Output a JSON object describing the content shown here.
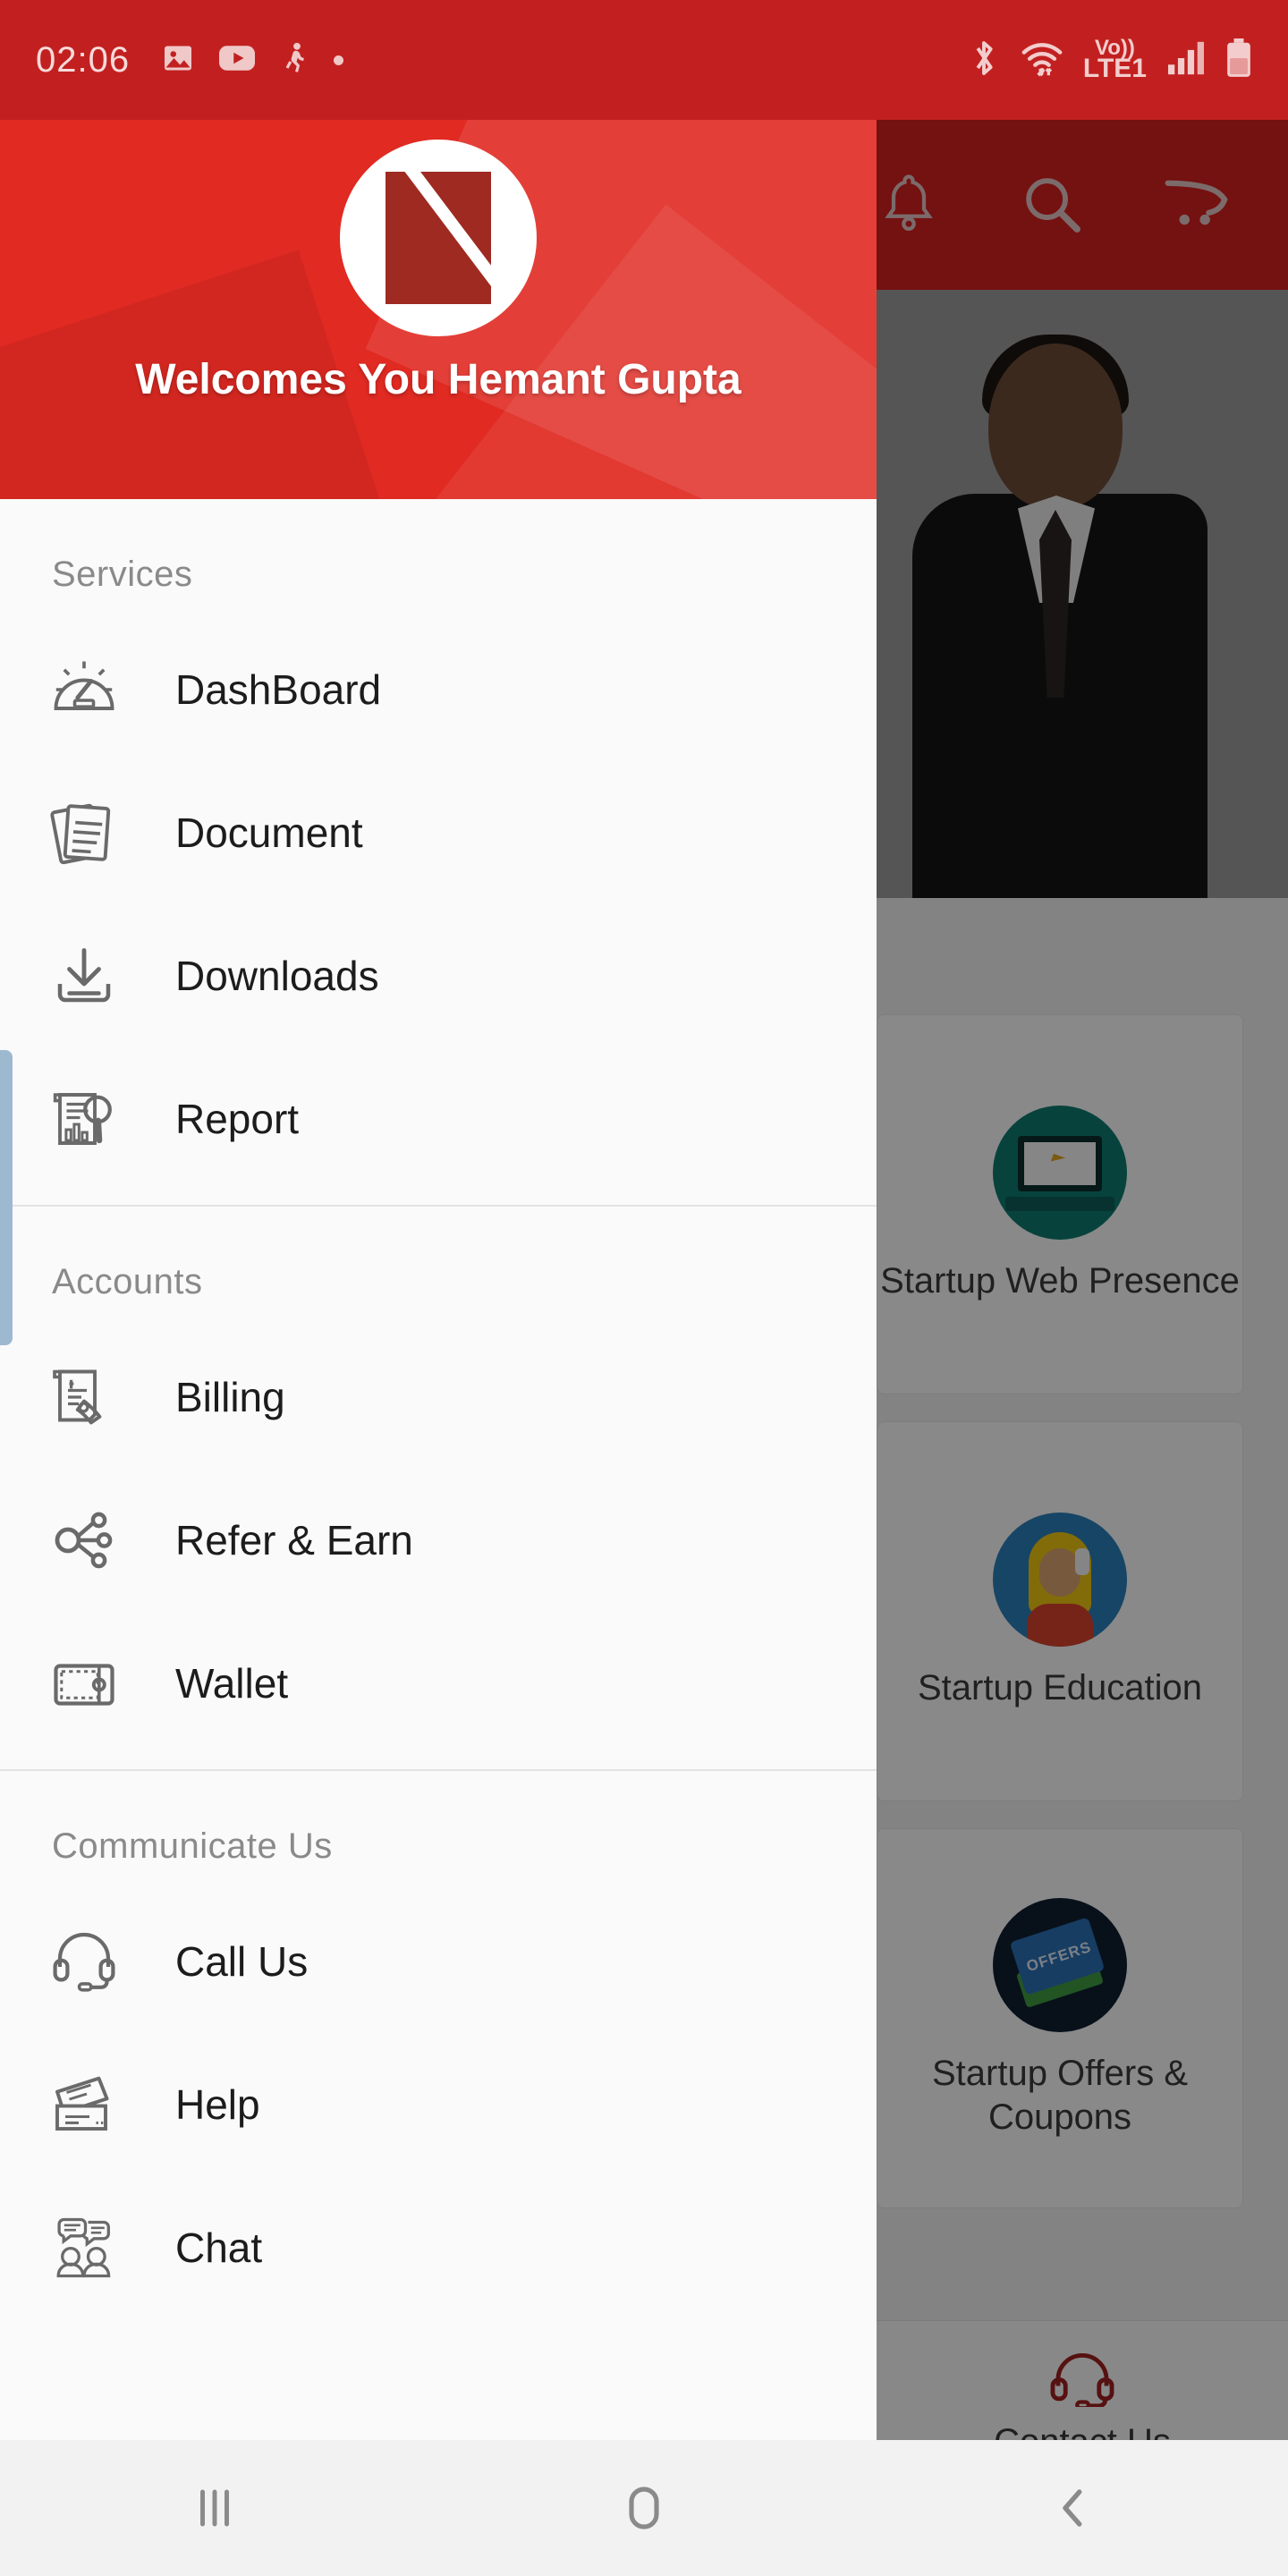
{
  "status_bar": {
    "clock": "02:06",
    "left_icons": [
      "gallery-icon",
      "youtube-icon",
      "fitness-icon",
      "dot-indicator"
    ],
    "right_icons": [
      "bluetooth-icon",
      "wifi-icon",
      "signal-icon",
      "battery-icon"
    ],
    "network_label_top": "Vo))",
    "network_label_bottom": "LTE1",
    "background_color": "#c22020"
  },
  "toolbar": {
    "background_color": "#d32020",
    "actions": [
      {
        "name": "notifications-icon",
        "label": "Notifications"
      },
      {
        "name": "search-icon",
        "label": "Search"
      },
      {
        "name": "cart-icon",
        "label": "Cart"
      }
    ]
  },
  "drawer": {
    "header": {
      "welcome_text": "Welcomes You  Hemant Gupta",
      "user_name": "Hemant Gupta",
      "logo_name": "app-logo",
      "background_color": "#e02a22"
    },
    "sections": [
      {
        "title": "Services",
        "items": [
          {
            "label": "DashBoard",
            "icon": "speedometer-icon"
          },
          {
            "label": "Document",
            "icon": "documents-icon"
          },
          {
            "label": "Downloads",
            "icon": "download-icon"
          },
          {
            "label": "Report",
            "icon": "report-search-icon"
          }
        ]
      },
      {
        "title": "Accounts",
        "items": [
          {
            "label": "Billing",
            "icon": "invoice-icon"
          },
          {
            "label": "Refer & Earn",
            "icon": "share-network-icon"
          },
          {
            "label": "Wallet",
            "icon": "wallet-icon"
          }
        ]
      },
      {
        "title": "Communicate Us",
        "items": [
          {
            "label": "Call Us",
            "icon": "headset-icon"
          },
          {
            "label": "Help",
            "icon": "tickets-icon"
          },
          {
            "label": "Chat",
            "icon": "chat-people-icon"
          }
        ]
      }
    ]
  },
  "main": {
    "hero": {
      "name": "hero-banner-person"
    },
    "service_cards": [
      {
        "label": "Startup Web Presence",
        "icon": "laptop-icon",
        "circle_color": "#0e7a6e"
      },
      {
        "label": "Startup Education",
        "icon": "support-agent-icon",
        "circle_color": "#2b7fb8"
      },
      {
        "label": "Startup Offers & Coupons",
        "icon": "offers-tag-icon",
        "circle_color": "#102030"
      }
    ],
    "offers_tag_text": "OFFERS",
    "contact_bar": {
      "label": "Contact Us",
      "icon": "headset-icon",
      "color": "#9e1f1f"
    }
  },
  "nav_bar": {
    "buttons": [
      {
        "name": "recents-button",
        "label": "Recents"
      },
      {
        "name": "home-button",
        "label": "Home"
      },
      {
        "name": "back-button",
        "label": "Back"
      }
    ]
  }
}
